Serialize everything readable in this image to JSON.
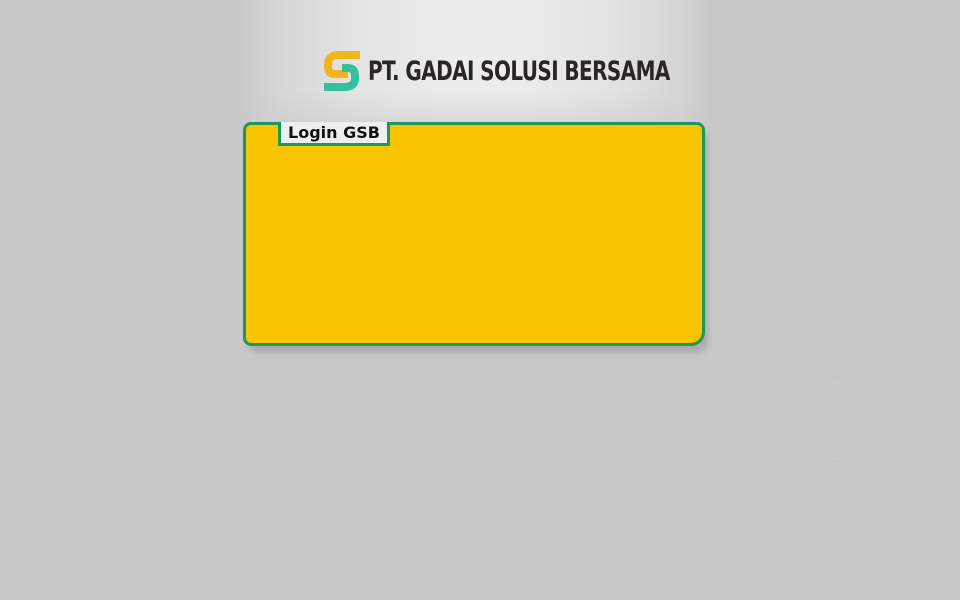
{
  "brand": {
    "company_name": "PT. GADAI SOLUSI BERSAMA",
    "logo_icon": "gsb-logo-icon"
  },
  "login_panel": {
    "tab_label": "Login GSB"
  },
  "colors": {
    "background": "#c8c8c8",
    "panel_fill": "#f8c500",
    "panel_border": "#1d9760",
    "logo_yellow": "#f2b51b",
    "logo_green": "#33c09a",
    "brand_text": "#2a2623"
  }
}
